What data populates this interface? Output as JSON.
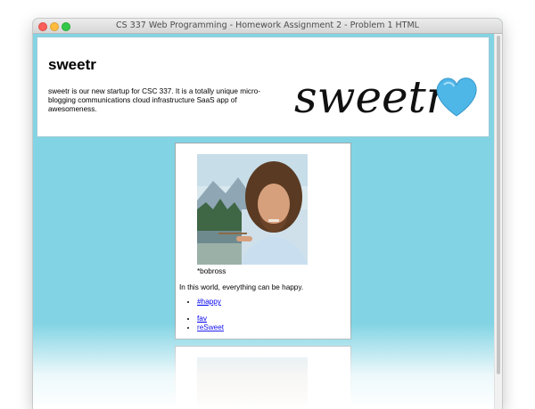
{
  "window": {
    "title": "CS 337 Web Programming - Homework Assignment 2 - Problem 1 HTML"
  },
  "header": {
    "title": "sweetr",
    "tagline": "sweetr is our new startup for CSC 337. It is a totally unique micro-blogging communications cloud infrastructure SaaS app of awesomeness.",
    "logo_text": "sweetr"
  },
  "post": {
    "username": "*bobross",
    "message": "In this world, everything can be happy.",
    "hashtags": [
      "#happy"
    ],
    "actions": [
      "fav",
      "reSweet"
    ]
  },
  "colors": {
    "background": "#82d4e4",
    "card_background": "#ffffff",
    "link": "#0000ee",
    "heart": "#4fb6e8"
  }
}
